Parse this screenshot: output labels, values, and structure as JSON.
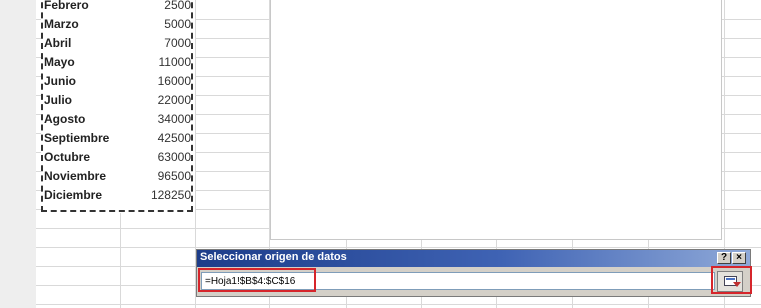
{
  "sheet": {
    "rows": [
      {
        "month": "Febrero",
        "amount": "2500"
      },
      {
        "month": "Marzo",
        "amount": "5000"
      },
      {
        "month": "Abril",
        "amount": "7000"
      },
      {
        "month": "Mayo",
        "amount": "11000"
      },
      {
        "month": "Junio",
        "amount": "16000"
      },
      {
        "month": "Julio",
        "amount": "22000"
      },
      {
        "month": "Agosto",
        "amount": "34000"
      },
      {
        "month": "Septiembre",
        "amount": "42500"
      },
      {
        "month": "Octubre",
        "amount": "63000"
      },
      {
        "month": "Noviembre",
        "amount": "96500"
      },
      {
        "month": "Diciembre",
        "amount": "128250"
      }
    ]
  },
  "dialog": {
    "title": "Seleccionar origen de datos",
    "help_label": "?",
    "close_label": "×",
    "range_value": "=Hoja1!$B$4:$C$16"
  },
  "colors": {
    "highlight": "#d6252b",
    "titlebar": "#1d3d8a"
  }
}
